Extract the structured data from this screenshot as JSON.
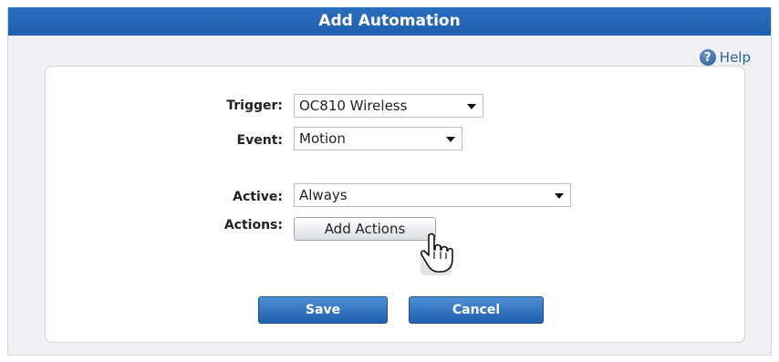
{
  "dialog": {
    "title": "Add Automation",
    "help_label": "Help",
    "help_icon": "question-circle-icon"
  },
  "form": {
    "trigger": {
      "label": "Trigger:",
      "value": "OC810 Wireless"
    },
    "event": {
      "label": "Event:",
      "value": "Motion"
    },
    "active": {
      "label": "Active:",
      "value": "Always"
    },
    "actions": {
      "label": "Actions:",
      "button_label": "Add Actions"
    }
  },
  "buttons": {
    "save_label": "Save",
    "cancel_label": "Cancel"
  },
  "colors": {
    "title_bar": "#1f5fad",
    "primary_button": "#1f5fad",
    "background": "#eef0f3"
  }
}
